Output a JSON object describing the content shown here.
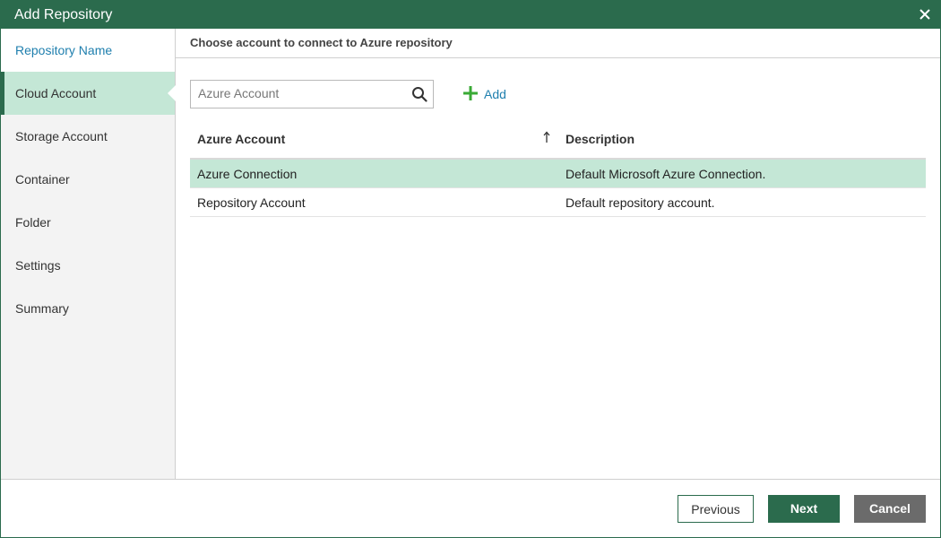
{
  "window": {
    "title": "Add Repository",
    "close_icon": "close-icon"
  },
  "steps": [
    {
      "label": "Repository Name",
      "state": "done"
    },
    {
      "label": "Cloud Account",
      "state": "active"
    },
    {
      "label": "Storage Account",
      "state": "pending"
    },
    {
      "label": "Container",
      "state": "pending"
    },
    {
      "label": "Folder",
      "state": "pending"
    },
    {
      "label": "Settings",
      "state": "pending"
    },
    {
      "label": "Summary",
      "state": "pending"
    }
  ],
  "main": {
    "heading": "Choose account to connect to Azure repository",
    "search": {
      "placeholder": "Azure Account",
      "value": "",
      "icon": "search-icon"
    },
    "add_button": {
      "label": "Add",
      "icon": "plus-icon"
    },
    "table": {
      "columns": [
        "Azure Account",
        "Description"
      ],
      "sort_column": "Azure Account",
      "sort_direction": "ascending",
      "rows": [
        {
          "account": "Azure Connection",
          "description": "Default Microsoft Azure Connection.",
          "selected": true
        },
        {
          "account": "Repository Account",
          "description": "Default repository account.",
          "selected": false
        }
      ]
    }
  },
  "footer": {
    "previous_label": "Previous",
    "next_label": "Next",
    "cancel_label": "Cancel"
  },
  "colors": {
    "brand": "#2b6b4d",
    "selection": "#c4e7d6",
    "link": "#1f7fae",
    "cancel": "#6b6b6b"
  }
}
